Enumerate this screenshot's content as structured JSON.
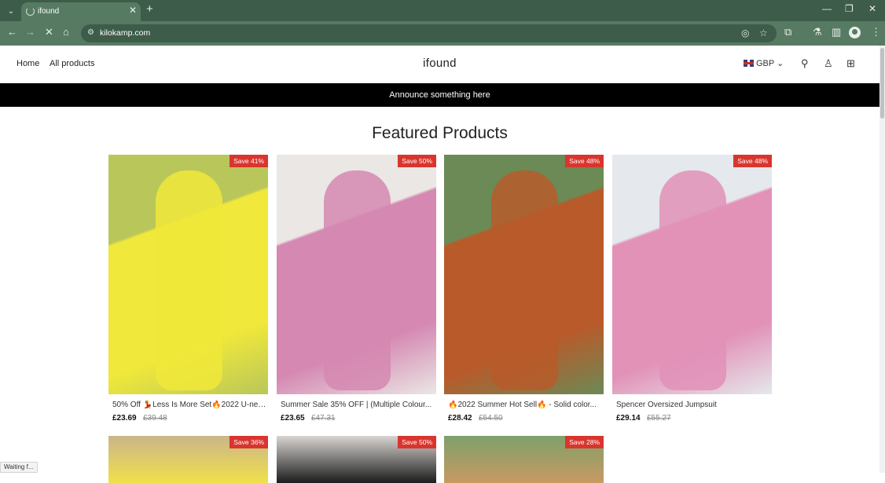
{
  "browser": {
    "tab_title": "ifound",
    "url": "kilokamp.com",
    "status_text": "Waiting f..."
  },
  "site": {
    "nav": [
      "Home",
      "All products"
    ],
    "logo": "ifound",
    "currency": "GBP",
    "announcement": "Announce something here",
    "section_title": "Featured Products"
  },
  "products": [
    {
      "badge": "Save 41%",
      "title": "50% Off 💃Less Is More Set🔥2022 U-nec...",
      "price": "£23.69",
      "compare": "£39.48",
      "colors": [
        "#f0e83a",
        "#b9c75a"
      ]
    },
    {
      "badge": "Save 50%",
      "title": "Summer Sale 35% OFF | (Multiple Colour...",
      "price": "£23.65",
      "compare": "£47.31",
      "colors": [
        "#d588b2",
        "#eae7e4"
      ]
    },
    {
      "badge": "Save 48%",
      "title": "🔥2022 Summer Hot Sell🔥 - Solid color...",
      "price": "£28.42",
      "compare": "£54.50",
      "colors": [
        "#b95a2a",
        "#6b8a56"
      ]
    },
    {
      "badge": "Save 48%",
      "title": "Spencer Oversized Jumpsuit",
      "price": "£29.14",
      "compare": "£55.27",
      "colors": [
        "#e291b7",
        "#e5e8ec"
      ]
    }
  ],
  "products_row2": [
    {
      "badge": "Save 36%",
      "colors": [
        "#f0e04a",
        "#cbb58a"
      ]
    },
    {
      "badge": "Save 50%",
      "colors": [
        "#1c1c1c",
        "#d8d4d0"
      ]
    },
    {
      "badge": "Save 28%",
      "colors": [
        "#c89a62",
        "#7fa06a"
      ]
    }
  ],
  "colors": {
    "chrome_dark": "#3d5c49",
    "chrome_light": "#577a62",
    "announce_bg": "#000000",
    "badge_bg": "#d9352e"
  }
}
